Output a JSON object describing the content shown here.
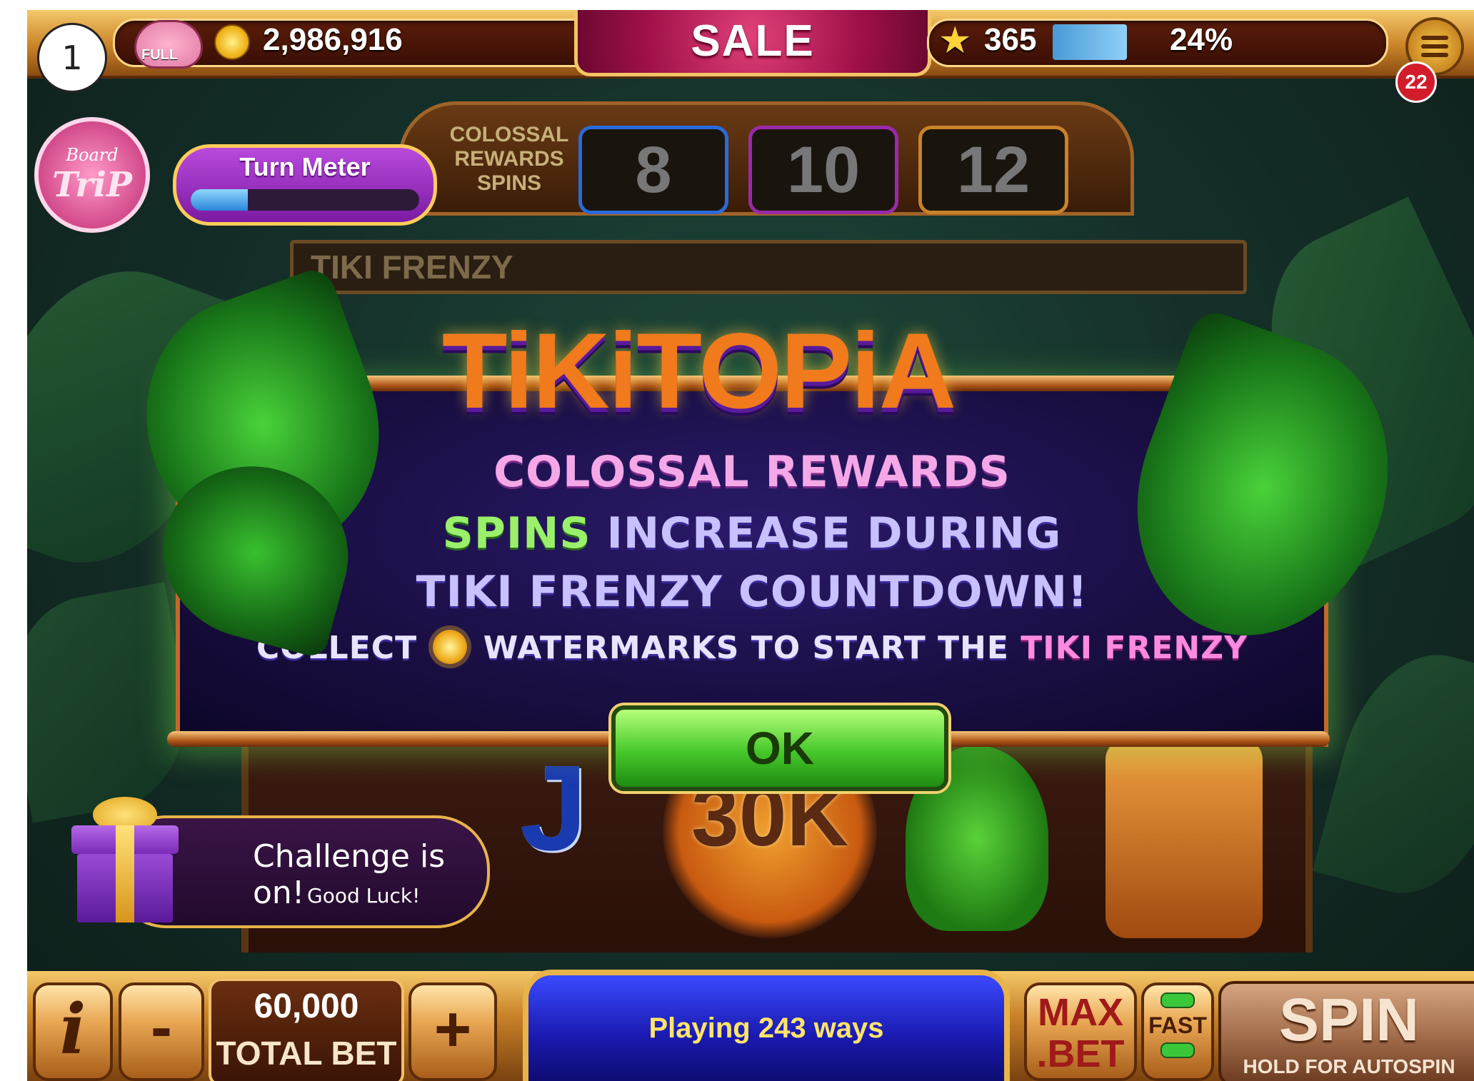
{
  "step_number": "1",
  "top_bar": {
    "piggy_label": "FULL",
    "coins": "2,986,916",
    "sale_label": "SALE",
    "level": "365",
    "level_progress": "24%",
    "notification_count": "22"
  },
  "board_trip": {
    "line1": "Board",
    "line2": "TriP"
  },
  "turn_meter": {
    "label": "Turn Meter",
    "progress_fraction": 0.25
  },
  "reels_header": {
    "label_lines": [
      "COLOSSAL",
      "REWARDS",
      "SPINS"
    ],
    "spin_options": [
      "8",
      "10",
      "12"
    ],
    "frenzy_label": "TIKI FRENZY"
  },
  "dialog": {
    "logo": "TiKiTOPiA",
    "line1": "COLOSSAL REWARDS",
    "line2_a": "SPINS",
    "line2_b": "INCREASE DURING",
    "line3": "TIKI FRENZY COUNTDOWN!",
    "line4_a": "COLLECT",
    "line4_b": "WATERMARKS TO START THE",
    "line4_c": "TIKI FRENZY",
    "ok_label": "OK"
  },
  "reel_symbols": {
    "jack": "J",
    "jackpot": "30K"
  },
  "challenge": {
    "title": "Challenge is on!",
    "subtitle": "Good Luck!"
  },
  "bottom_bar": {
    "info_label": "i",
    "minus_label": "-",
    "bet_value": "60,000",
    "bet_label": "TOTAL BET",
    "plus_label": "+",
    "ways_text": "Playing 243 ways",
    "max_bet_line1": "MAX",
    "max_bet_line2": ".BET",
    "fast_label": "FAST",
    "spin_label": "SPIN",
    "spin_sub": "HOLD FOR AUTOSPIN"
  },
  "colors": {
    "accent_gold": "#e8b44a",
    "sale_pink": "#a01048",
    "ok_green": "#46c82a",
    "dialog_bg": "#160c3a"
  }
}
